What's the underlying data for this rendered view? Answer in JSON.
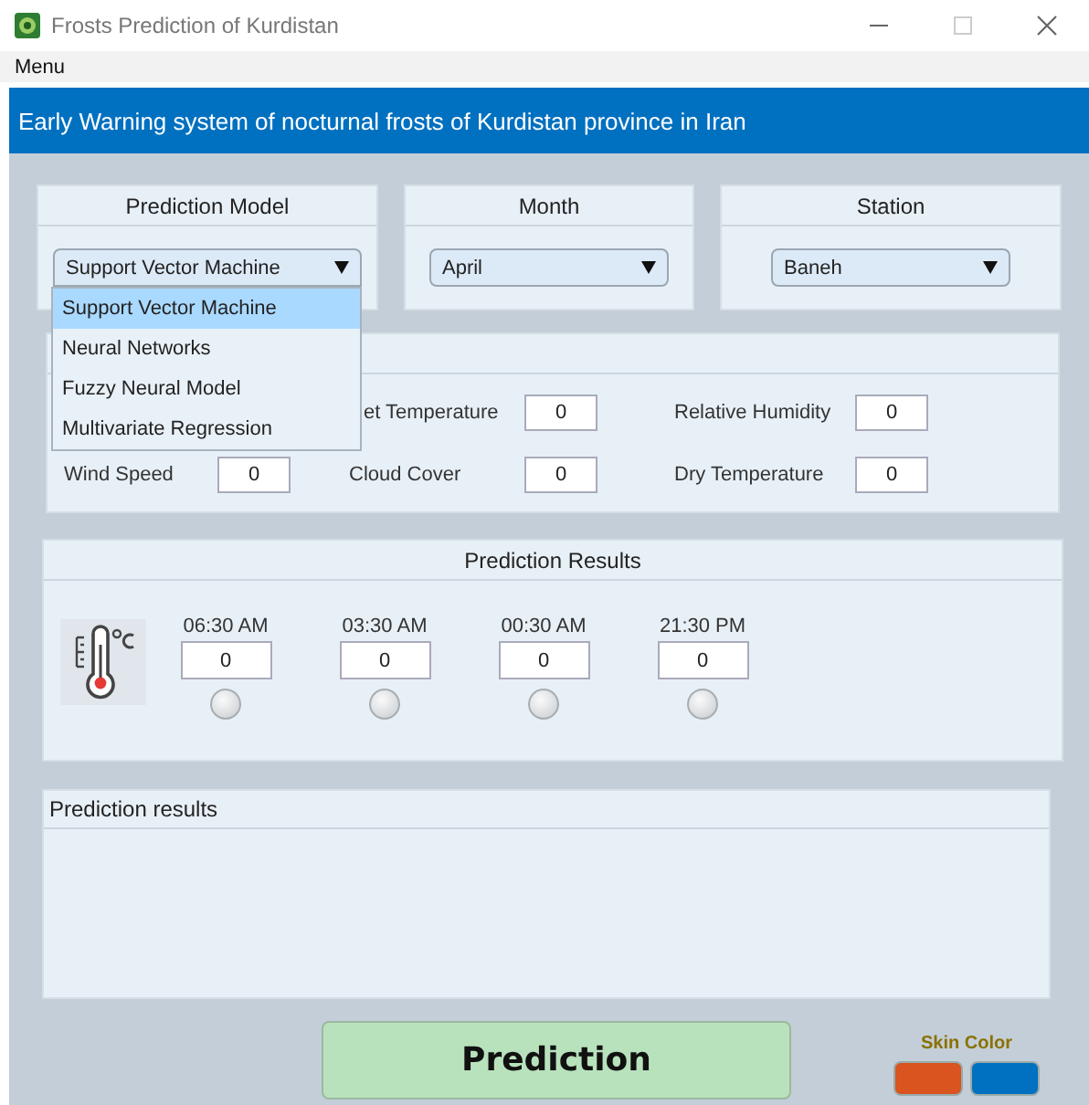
{
  "window": {
    "title": "Frosts Prediction of Kurdistan"
  },
  "menu_bar": [
    "Menu"
  ],
  "header": "Early Warning system of nocturnal frosts of Kurdistan province in Iran",
  "selectors": [
    {
      "label": "Prediction Model",
      "value": "Support Vector Machine",
      "expanded": true,
      "options": [
        {
          "label": "Support Vector Machine",
          "selected": true
        },
        {
          "label": "Neural Networks",
          "selected": false
        },
        {
          "label": "Fuzzy Neural Model",
          "selected": false
        },
        {
          "label": "Multivariate Regression",
          "selected": false
        }
      ]
    },
    {
      "label": "Month",
      "value": "April",
      "expanded": false
    },
    {
      "label": "Station",
      "value": "Baneh",
      "expanded": false
    }
  ],
  "inputs": {
    "rows": [
      {
        "fields": [
          {
            "label": "et Temperature",
            "value": "0"
          },
          {
            "label": "Relative Humidity",
            "value": "0"
          }
        ]
      },
      {
        "fields": [
          {
            "label": "Wind Speed",
            "value": "0"
          },
          {
            "label": "Cloud Cover",
            "value": "0"
          },
          {
            "label": "Dry Temperature",
            "value": "0"
          }
        ]
      }
    ]
  },
  "results": {
    "title": "Prediction Results",
    "times": [
      {
        "label": "06:30 AM",
        "value": "0"
      },
      {
        "label": "03:30 AM",
        "value": "0"
      },
      {
        "label": "00:30 AM",
        "value": "0"
      },
      {
        "label": "21:30 PM",
        "value": "0"
      }
    ]
  },
  "output": {
    "title": "Prediction results"
  },
  "action": {
    "button": "Prediction"
  },
  "skin": {
    "label": "Skin Color",
    "swatches": [
      {
        "color": "#d9541e"
      },
      {
        "color": "#0070c0"
      }
    ]
  }
}
